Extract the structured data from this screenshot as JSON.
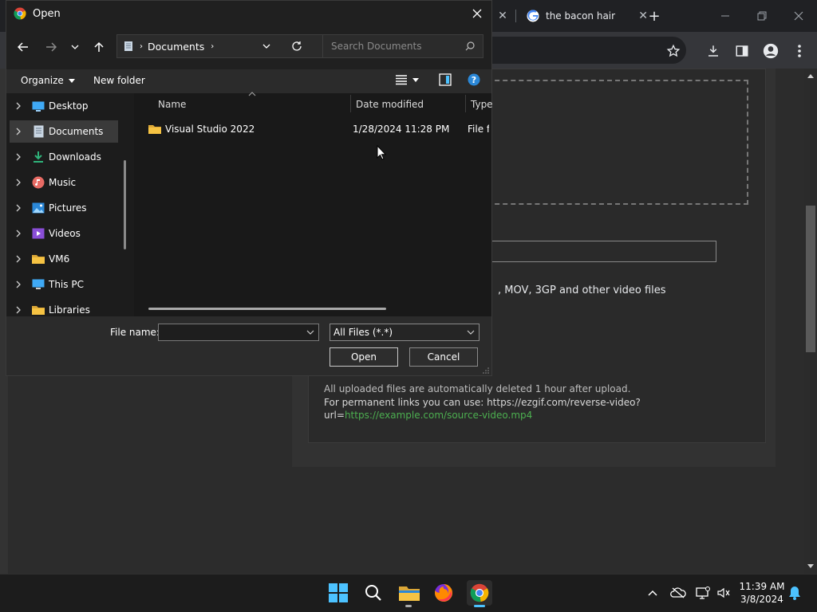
{
  "browser": {
    "active_tab_title": "the bacon hair",
    "prev_tab_close": "✕",
    "new_tab": "+"
  },
  "page": {
    "formats_text": ", MOV, 3GP and other video files",
    "info_line1": "All uploaded files are automatically deleted 1 hour after upload.",
    "info_line2": "For permanent links you can use: https://ezgif.com/reverse-video?",
    "info_line3_prefix": "url=",
    "info_line3_link": "https://example.com/source-video.mp4"
  },
  "dialog": {
    "title": "Open",
    "address_crumb": "Documents",
    "search_placeholder": "Search Documents",
    "organize_label": "Organize",
    "new_folder_label": "New folder",
    "nav_items": [
      {
        "label": "Desktop",
        "icon": "desktop-icon"
      },
      {
        "label": "Documents",
        "icon": "documents-icon",
        "selected": true
      },
      {
        "label": "Downloads",
        "icon": "downloads-icon"
      },
      {
        "label": "Music",
        "icon": "music-icon"
      },
      {
        "label": "Pictures",
        "icon": "pictures-icon"
      },
      {
        "label": "Videos",
        "icon": "videos-icon"
      },
      {
        "label": "VM6",
        "icon": "folder-icon"
      },
      {
        "label": "This PC",
        "icon": "this-pc-icon"
      },
      {
        "label": "Libraries",
        "icon": "libraries-icon"
      }
    ],
    "columns": {
      "name": "Name",
      "date": "Date modified",
      "type": "Type"
    },
    "files": [
      {
        "name": "Visual Studio 2022",
        "date": "1/28/2024 11:28 PM",
        "type": "File f"
      }
    ],
    "file_name_label": "File name:",
    "file_name_value": "",
    "filter_value": "All Files (*.*)",
    "open_label": "Open",
    "cancel_label": "Cancel"
  },
  "taskbar": {
    "time": "11:39 AM",
    "date": "3/8/2024"
  },
  "colors": {
    "accent_blue": "#4cc2ff",
    "link_green": "#4caf50",
    "folder_yellow": "#f6c343"
  }
}
